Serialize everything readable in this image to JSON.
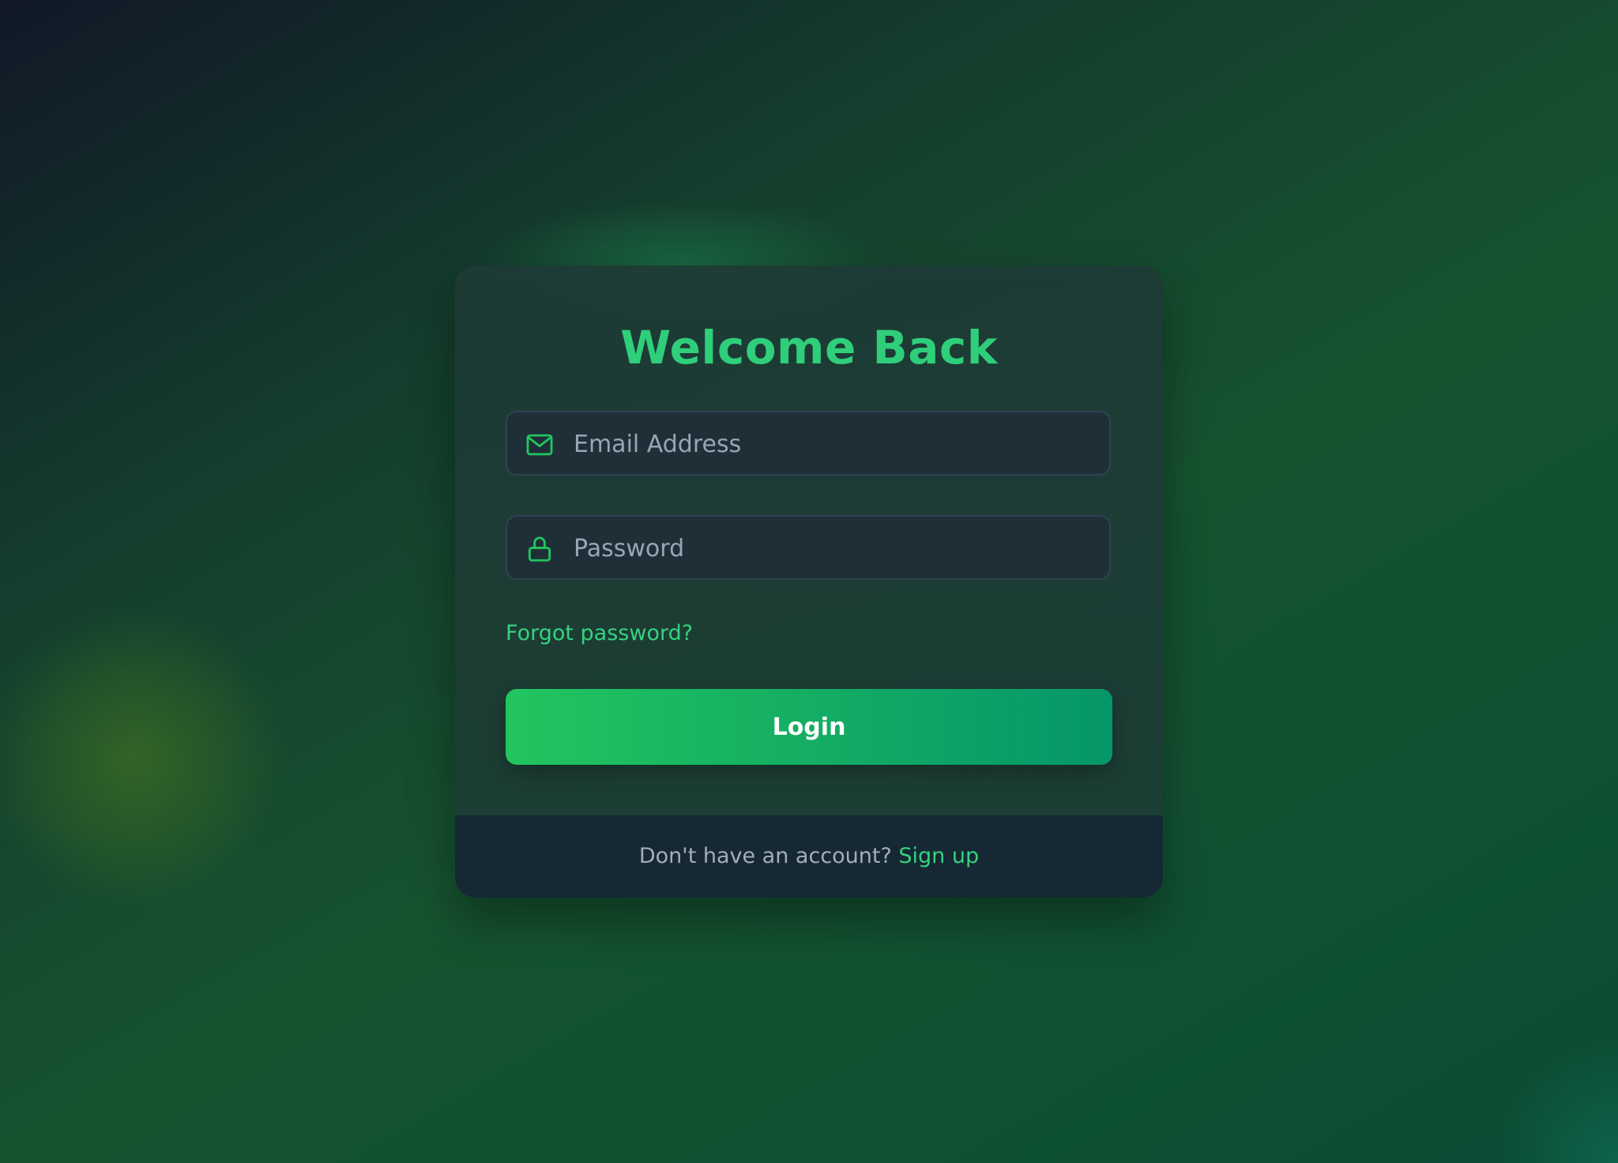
{
  "login_card": {
    "title": "Welcome Back",
    "email_field": {
      "placeholder": "Email Address",
      "value": "",
      "icon": "mail-icon"
    },
    "password_field": {
      "placeholder": "Password",
      "value": "",
      "icon": "lock-icon"
    },
    "forgot_password_label": "Forgot password?",
    "login_button_label": "Login",
    "footer": {
      "prompt": "Don't have an account?",
      "signup_label": "Sign up"
    }
  },
  "colors": {
    "accent": "#2fce7a",
    "button_start": "#22c55e",
    "button_end": "#059669",
    "card_bg": "#1e3a36",
    "footer_bg": "#152833",
    "muted_text": "#a3adb9"
  }
}
